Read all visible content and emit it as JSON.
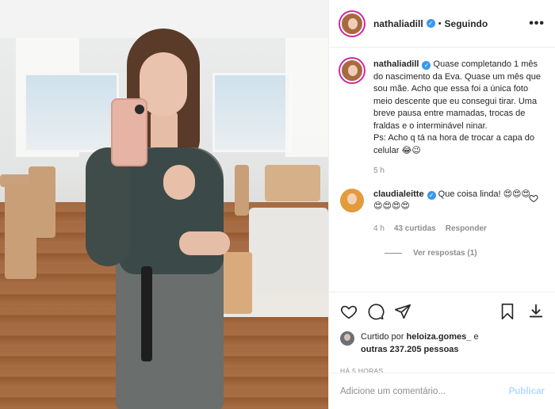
{
  "post": {
    "username": "nathaliadill",
    "follow_status": "Seguindo",
    "separator": "•",
    "more": "•••",
    "caption": {
      "username": "nathaliadill",
      "text": "Quase completando 1 mês do nascimento da Eva. Quase um mês que sou mãe. Acho que essa foi a única foto meio descente que eu consegui tirar. Uma breve pausa entre mamadas, trocas de fraldas e o interminável ninar.\nPs: Acho q tá na hora de trocar a capa do celular 😂😉",
      "age": "5 h"
    },
    "comment": {
      "username": "claudialeitte",
      "text": "Que coisa linda! 😍😍😍😍😍😍😍",
      "age": "4 h",
      "likes": "43 curtidas",
      "reply": "Responder",
      "view_replies": "Ver respostas (1)"
    },
    "likes": {
      "prefix": "Curtido por",
      "user": "heloiza.gomes_",
      "middle": "e",
      "others": "outras 237.205 pessoas"
    },
    "timestamp": "HÁ 5 HORAS",
    "add_comment": {
      "placeholder": "Adicione um comentário...",
      "publish": "Publicar"
    }
  },
  "colors": {
    "verified": "#3897f0",
    "publish_disabled": "#b3dbff",
    "meta_gray": "#8e8e8e",
    "story_ring": "#d6249f"
  },
  "icons": [
    "verified-badge-icon",
    "more-options-icon",
    "heart-icon",
    "comment-icon",
    "share-icon",
    "bookmark-icon",
    "download-icon",
    "comment-heart-icon"
  ]
}
